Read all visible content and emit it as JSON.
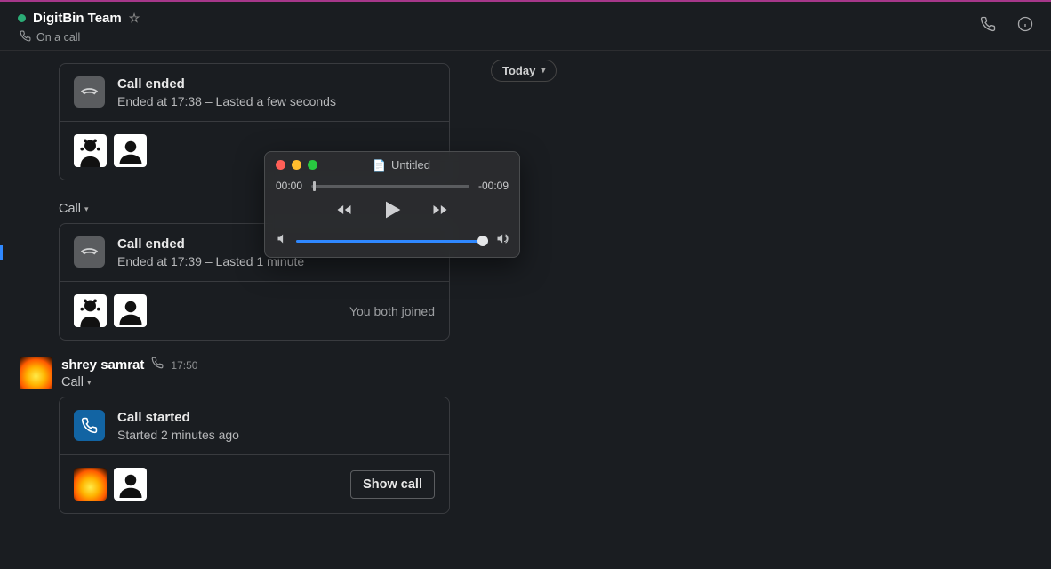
{
  "header": {
    "channel_name": "DigitBin Team",
    "status_text": "On a call"
  },
  "date_divider": "Today",
  "blocks": [
    {
      "kind": "card",
      "title": "Call ended",
      "subtitle": "Ended at 17:38 – Lasted a few seconds",
      "icon_variant": "ended",
      "avatars": [
        "bw",
        "persondefault"
      ],
      "note": "",
      "button": ""
    },
    {
      "kind": "call_label",
      "label": "Call"
    },
    {
      "kind": "card",
      "title": "Call ended",
      "subtitle": "Ended at 17:39 – Lasted 1 minute",
      "icon_variant": "ended",
      "avatars": [
        "bw",
        "persondefault"
      ],
      "note": "You both joined",
      "button": ""
    },
    {
      "kind": "message",
      "author": "shrey samrat",
      "time": "17:50",
      "call_label": "Call"
    },
    {
      "kind": "card",
      "title": "Call started",
      "subtitle": "Started 2 minutes ago",
      "icon_variant": "active",
      "avatars": [
        "fire",
        "persondefault"
      ],
      "note": "",
      "button": "Show call"
    }
  ],
  "player": {
    "title": "Untitled",
    "elapsed": "00:00",
    "remaining": "-00:09"
  }
}
